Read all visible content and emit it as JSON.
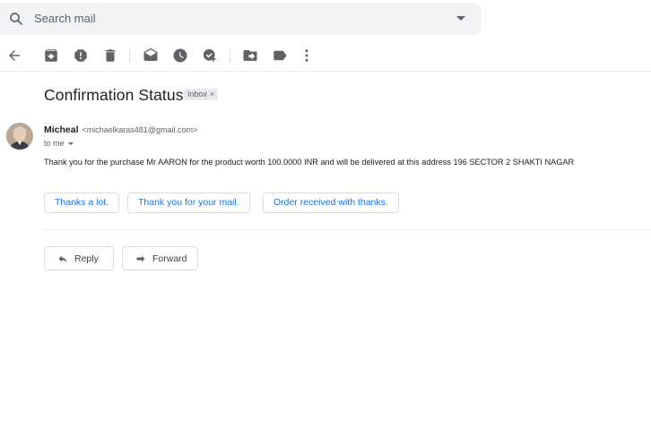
{
  "search": {
    "placeholder": "Search mail"
  },
  "toolbar": {
    "icons": [
      "back-arrow-icon",
      "archive-icon",
      "report-spam-icon",
      "delete-icon",
      "mark-unread-icon",
      "snooze-icon",
      "add-task-icon",
      "move-to-icon",
      "label-icon",
      "more-icon"
    ]
  },
  "message": {
    "subject": "Confirmation Status",
    "label_chip": "Inbox",
    "label_close": "×",
    "sender_name": "Micheal",
    "sender_email": "<michaelkaras481@gmail.com>",
    "recipient": "to me",
    "body": "Thank you for the purchase Mr AARON for the product worth 100.0000 INR and will be delivered at this address 196 SECTOR 2 SHAKTI NAGAR"
  },
  "smart_replies": [
    "Thanks a lot.",
    "Thank you for your mail.",
    "Order received with thanks."
  ],
  "actions": {
    "reply": "Reply",
    "forward": "Forward"
  },
  "colors": {
    "accent": "#1a73e8",
    "icon": "#5f6368",
    "border": "#dadce0",
    "search_bg": "#f1f3f4"
  }
}
